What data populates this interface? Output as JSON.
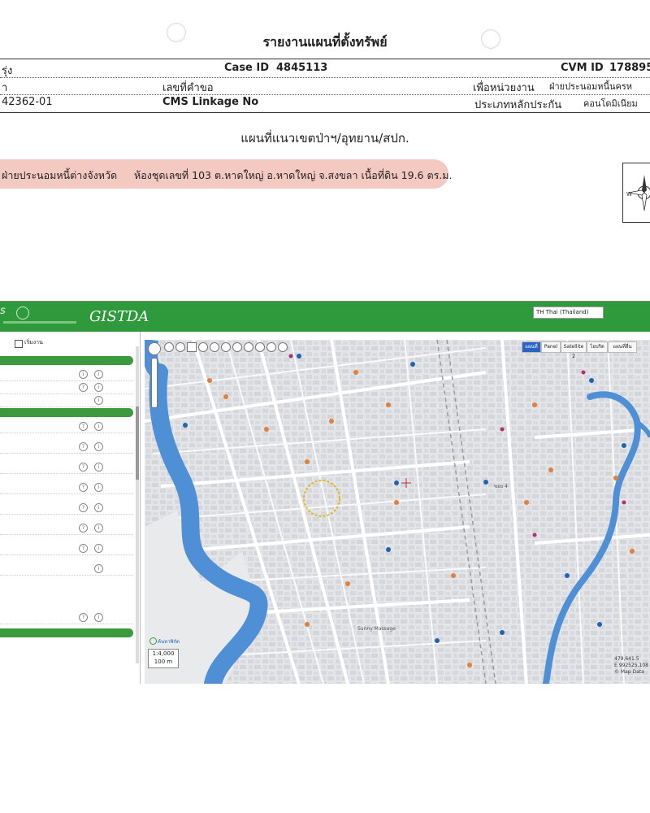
{
  "report": {
    "title": "รายงานแผนที่ตั้งทรัพย์",
    "row1": {
      "left": "รุ่ง",
      "case_label": "Case ID",
      "case_value": "4845113",
      "cvm_label": "CVM ID",
      "cvm_value": "178895"
    },
    "row2": {
      "left": "า",
      "request_label": "เลขที่คำขอ",
      "unit_label": "เพื่อหน่วยงาน",
      "unit_value": "ฝ่ายประนอมหนี้นครห"
    },
    "row3": {
      "left": "42362-01",
      "cms_label": "CMS Linkage No",
      "collateral_label": "ประเภทหลักประกัน",
      "collateral_value": "คอนโดมิเนียม"
    },
    "subtitle": "แผนที่แนวเขตป่าฯ/อุทยาน/สปก.",
    "banner_left": "ฝ่ายประนอมหนี้ต่างจังหวัด",
    "banner_right": "ห้องชุดเลขที่ 103 ต.หาดใหญ่ อ.หาดใหญ่ จ.สงขลา เนื้อที่ดิน  19.6 ตร.ม."
  },
  "app": {
    "brand_left": "s",
    "logo": "GISTDA",
    "language": "TH Thai (Thailand)",
    "sidebar_tool_label": "เริ่มงาน",
    "zoom_scale": "1:4,000",
    "scale_bar": "100 m",
    "map_search_label": "ค้นหาพิกัด",
    "coords": [
      "479,641.5",
      "E 992525.108",
      "© Map Data"
    ],
    "map_tabs": [
      "แผนที่",
      "Panel",
      "Satellite 2",
      "ไฮบริด",
      "แผนที่อื่น"
    ],
    "map_labels": [
      "Sunny Massage",
      "ซอย 4"
    ]
  },
  "colors": {
    "app_green": "#2f9a3c",
    "banner_pink": "#f4c9c1",
    "water_blue": "#4f8fd6"
  }
}
